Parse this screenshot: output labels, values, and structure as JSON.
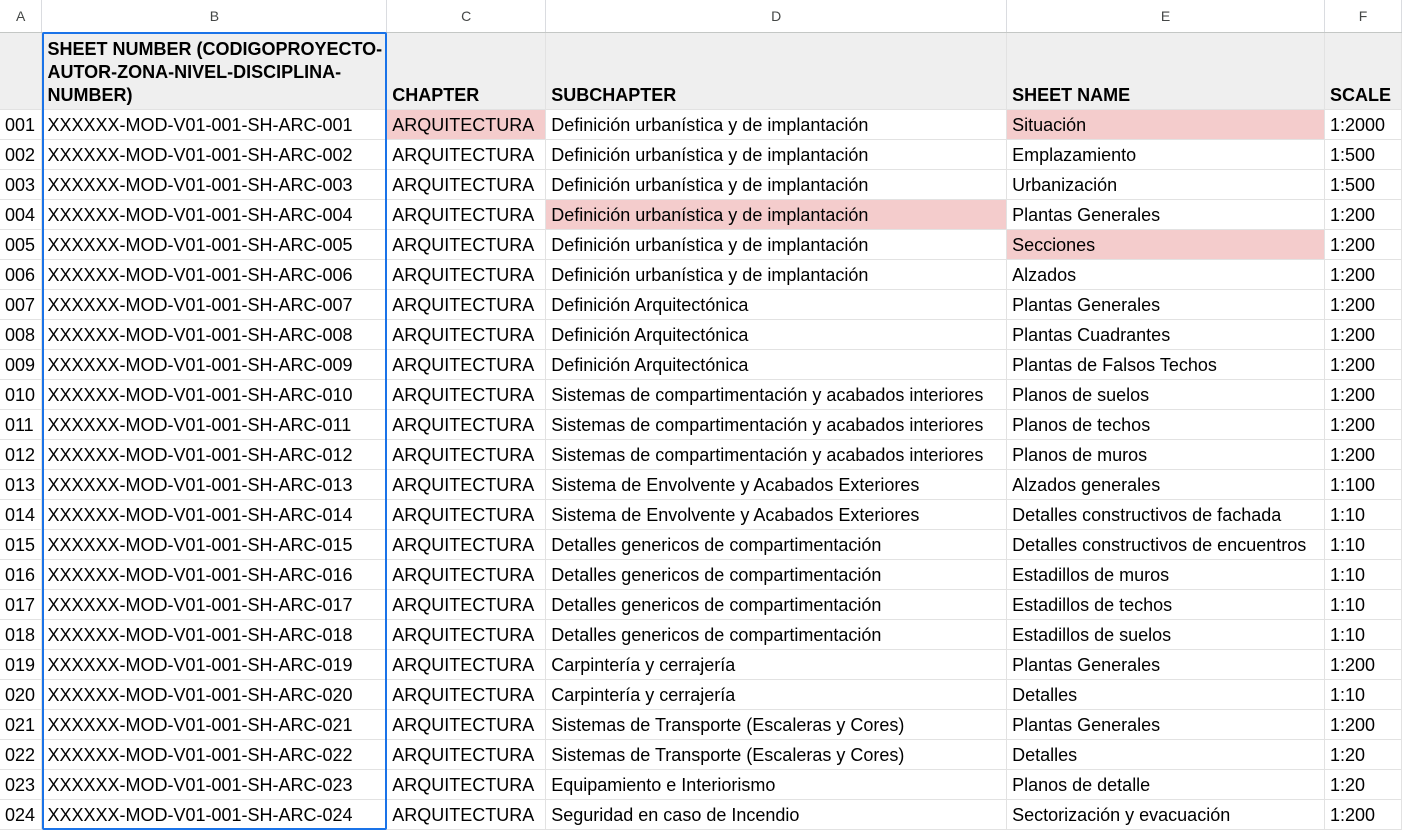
{
  "columns": [
    "A",
    "B",
    "C",
    "D",
    "E",
    "F"
  ],
  "header": {
    "a": "",
    "sheet_number": "SHEET NUMBER (CODIGOPROYECTO-AUTOR-ZONA-NIVEL-DISCIPLINA-NUMBER)",
    "chapter": "CHAPTER",
    "subchapter": "SUBCHAPTER",
    "sheet_name": "SHEET NAME",
    "scale": "SCALE"
  },
  "rows": [
    {
      "a": "001",
      "sheet": "XXXXXX-MOD-V01-001-SH-ARC-001",
      "chapter": "ARQUITECTURA",
      "sub": "Definición urbanística y de implantación",
      "name": "Situación",
      "scale": "1:2000"
    },
    {
      "a": "002",
      "sheet": "XXXXXX-MOD-V01-001-SH-ARC-002",
      "chapter": "ARQUITECTURA",
      "sub": "Definición urbanística y de implantación",
      "name": "Emplazamiento",
      "scale": "1:500"
    },
    {
      "a": "003",
      "sheet": "XXXXXX-MOD-V01-001-SH-ARC-003",
      "chapter": "ARQUITECTURA",
      "sub": "Definición urbanística y de implantación",
      "name": "Urbanización",
      "scale": "1:500"
    },
    {
      "a": "004",
      "sheet": "XXXXXX-MOD-V01-001-SH-ARC-004",
      "chapter": "ARQUITECTURA",
      "sub": "Definición urbanística y de implantación",
      "name": "Plantas Generales",
      "scale": "1:200"
    },
    {
      "a": "005",
      "sheet": "XXXXXX-MOD-V01-001-SH-ARC-005",
      "chapter": "ARQUITECTURA",
      "sub": "Definición urbanística y de implantación",
      "name": "Secciones",
      "scale": "1:200"
    },
    {
      "a": "006",
      "sheet": "XXXXXX-MOD-V01-001-SH-ARC-006",
      "chapter": "ARQUITECTURA",
      "sub": "Definición urbanística y de implantación",
      "name": "Alzados",
      "scale": "1:200"
    },
    {
      "a": "007",
      "sheet": "XXXXXX-MOD-V01-001-SH-ARC-007",
      "chapter": "ARQUITECTURA",
      "sub": "Definición Arquitectónica",
      "name": "Plantas Generales",
      "scale": "1:200"
    },
    {
      "a": "008",
      "sheet": "XXXXXX-MOD-V01-001-SH-ARC-008",
      "chapter": "ARQUITECTURA",
      "sub": "Definición Arquitectónica",
      "name": "Plantas Cuadrantes",
      "scale": "1:200"
    },
    {
      "a": "009",
      "sheet": "XXXXXX-MOD-V01-001-SH-ARC-009",
      "chapter": "ARQUITECTURA",
      "sub": "Definición Arquitectónica",
      "name": "Plantas de Falsos Techos",
      "scale": "1:200"
    },
    {
      "a": "010",
      "sheet": "XXXXXX-MOD-V01-001-SH-ARC-010",
      "chapter": "ARQUITECTURA",
      "sub": "Sistemas de compartimentación y acabados interiores",
      "name": "Planos de suelos",
      "scale": "1:200"
    },
    {
      "a": "011",
      "sheet": "XXXXXX-MOD-V01-001-SH-ARC-011",
      "chapter": "ARQUITECTURA",
      "sub": "Sistemas de compartimentación y acabados interiores",
      "name": "Planos de techos",
      "scale": "1:200"
    },
    {
      "a": "012",
      "sheet": "XXXXXX-MOD-V01-001-SH-ARC-012",
      "chapter": "ARQUITECTURA",
      "sub": "Sistemas de compartimentación y acabados interiores",
      "name": "Planos de muros",
      "scale": "1:200"
    },
    {
      "a": "013",
      "sheet": "XXXXXX-MOD-V01-001-SH-ARC-013",
      "chapter": "ARQUITECTURA",
      "sub": "Sistema de Envolvente y Acabados Exteriores",
      "name": "Alzados generales",
      "scale": "1:100"
    },
    {
      "a": "014",
      "sheet": "XXXXXX-MOD-V01-001-SH-ARC-014",
      "chapter": "ARQUITECTURA",
      "sub": "Sistema de Envolvente y Acabados Exteriores",
      "name": "Detalles constructivos de fachada",
      "scale": "1:10"
    },
    {
      "a": "015",
      "sheet": "XXXXXX-MOD-V01-001-SH-ARC-015",
      "chapter": "ARQUITECTURA",
      "sub": "Detalles genericos de compartimentación",
      "name": "Detalles constructivos de encuentros",
      "scale": "1:10"
    },
    {
      "a": "016",
      "sheet": "XXXXXX-MOD-V01-001-SH-ARC-016",
      "chapter": "ARQUITECTURA",
      "sub": "Detalles genericos de compartimentación",
      "name": "Estadillos de muros",
      "scale": "1:10"
    },
    {
      "a": "017",
      "sheet": "XXXXXX-MOD-V01-001-SH-ARC-017",
      "chapter": "ARQUITECTURA",
      "sub": "Detalles genericos de compartimentación",
      "name": "Estadillos de techos",
      "scale": "1:10"
    },
    {
      "a": "018",
      "sheet": "XXXXXX-MOD-V01-001-SH-ARC-018",
      "chapter": "ARQUITECTURA",
      "sub": "Detalles genericos de compartimentación",
      "name": "Estadillos de suelos",
      "scale": "1:10"
    },
    {
      "a": "019",
      "sheet": "XXXXXX-MOD-V01-001-SH-ARC-019",
      "chapter": "ARQUITECTURA",
      "sub": "Carpintería y cerrajería",
      "name": "Plantas Generales",
      "scale": "1:200"
    },
    {
      "a": "020",
      "sheet": "XXXXXX-MOD-V01-001-SH-ARC-020",
      "chapter": "ARQUITECTURA",
      "sub": "Carpintería y cerrajería",
      "name": "Detalles",
      "scale": "1:10"
    },
    {
      "a": "021",
      "sheet": "XXXXXX-MOD-V01-001-SH-ARC-021",
      "chapter": "ARQUITECTURA",
      "sub": "Sistemas de Transporte (Escaleras y Cores)",
      "name": "Plantas Generales",
      "scale": "1:200"
    },
    {
      "a": "022",
      "sheet": "XXXXXX-MOD-V01-001-SH-ARC-022",
      "chapter": "ARQUITECTURA",
      "sub": "Sistemas de Transporte (Escaleras y Cores)",
      "name": "Detalles",
      "scale": "1:20"
    },
    {
      "a": "023",
      "sheet": "XXXXXX-MOD-V01-001-SH-ARC-023",
      "chapter": "ARQUITECTURA",
      "sub": "Equipamiento e Interiorismo",
      "name": "Planos de detalle",
      "scale": "1:20"
    },
    {
      "a": "024",
      "sheet": "XXXXXX-MOD-V01-001-SH-ARC-024",
      "chapter": "ARQUITECTURA",
      "sub": "Seguridad en caso de Incendio",
      "name": "Sectorización y evacuación",
      "scale": "1:200"
    }
  ],
  "highlights": [
    {
      "row": 0,
      "col": "chapter"
    },
    {
      "row": 0,
      "col": "name"
    },
    {
      "row": 3,
      "col": "sub"
    },
    {
      "row": 4,
      "col": "name"
    }
  ],
  "colors": {
    "highlight": "#f4cccc",
    "selection": "#1a73e8",
    "header_bg": "#efefef"
  }
}
